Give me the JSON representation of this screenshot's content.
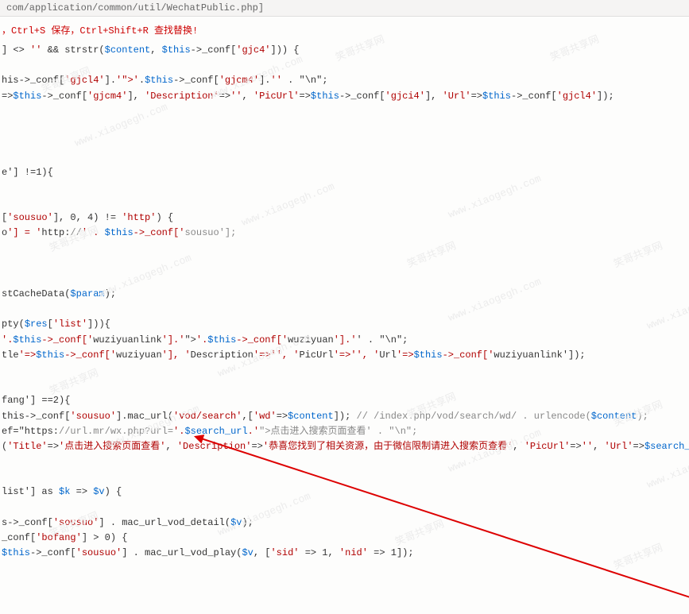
{
  "header": {
    "path": "com/application/common/util/WechatPublic.php]"
  },
  "instr": {
    "p1": "，Ctrl+S 保存，Ctrl+Shift+R 查找替换!"
  },
  "code": {
    "l1": "] <> '' && strstr($content, $this->_conf['gjc4'])) {",
    "l2": "his->_conf['gjcl4'].'\">'.$this->_conf['gjcm4'].'</a>' . \"\\n\";",
    "l3": "=>$this->_conf['gjcm4'], 'Description'=>'', 'PicUrl'=>$this->_conf['gjci4'], 'Url'=>$this->_conf['gjcl4']);",
    "l4": "e'] !=1){",
    "l5": "['sousuo'], 0, 4) != 'http') {",
    "l6": "o'] = 'http://' . $this->_conf['sousuo'];",
    "l7": "stCacheData($param);",
    "l8": "pty($res['list'])){",
    "l9": "'.$this->_conf['wuziyuanlink'].'\">'.$this->_conf['wuziyuan'].'</a>' . \"\\n\";",
    "l10": "tle'=>$this->_conf['wuziyuan'], 'Description'=>'', 'PicUrl'=>'', 'Url'=>$this->_conf['wuziyuanlink']);",
    "l11": "fang'] ==2){",
    "l12": "this->_conf['sousuo'].mac_url('vod/search',['wd'=>$content]); // /index.php/vod/search/wd/ . urlencode($content);",
    "l13": "ef=\"https://url.mr/wx.php?url='.$search_url.'\">点击进入搜索页面查看</a>' . \"\\n\";",
    "l14": "('Title'=>'点击进入搜索页面查看', 'Description'=>'恭喜您找到了相关资源，由于微信限制请进入搜索页查看', 'PicUrl'=>'', 'Url'=>$search_url );",
    "l15": "list'] as $k => $v) {",
    "l16": "s->_conf['sousuo'] . mac_url_vod_detail($v);",
    "l17": "_conf['bofang'] > 0) {",
    "l18": "$this->_conf['sousuo'] . mac_url_vod_play($v, ['sid' => 1, 'nid' => 1]);"
  },
  "wm": {
    "a": "笑哥共享网",
    "b": "www.xiaogegh.com"
  }
}
